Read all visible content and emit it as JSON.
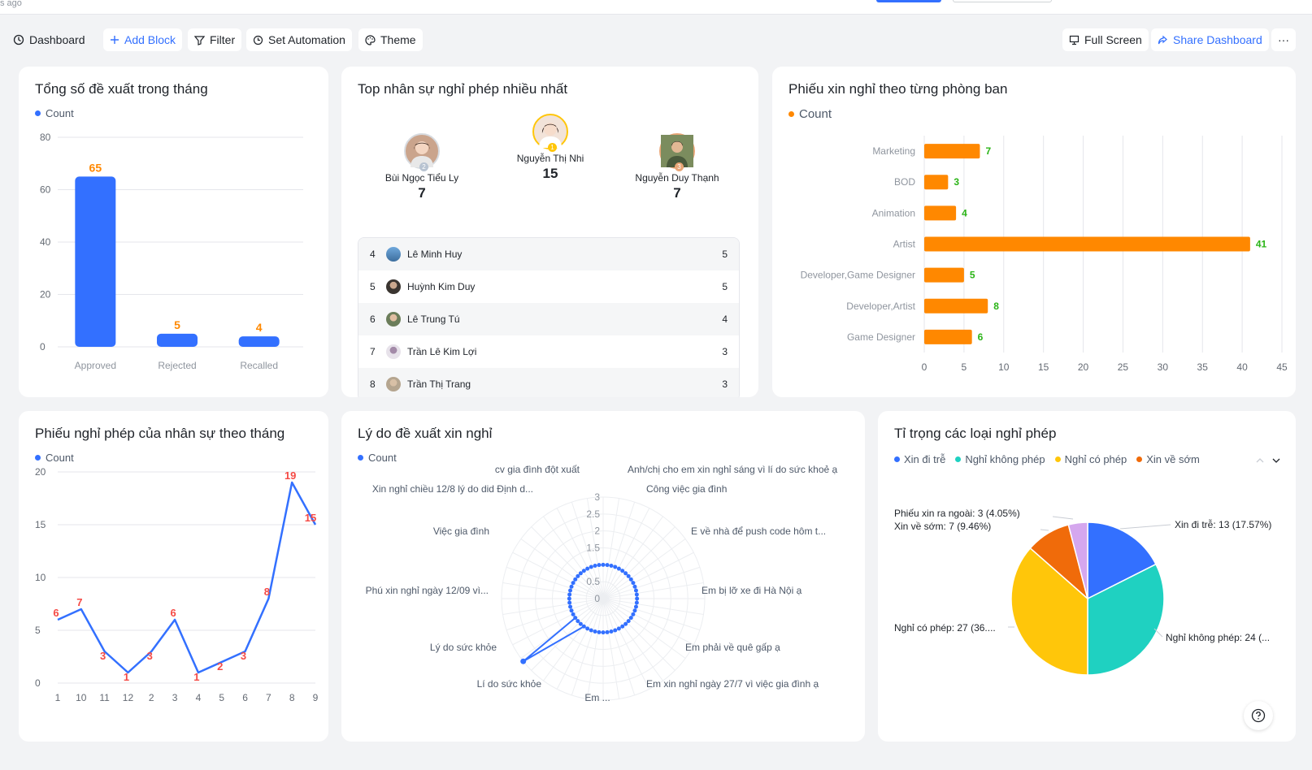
{
  "topbar": {
    "ago_text": "s ago"
  },
  "toolbar": {
    "dashboard_label": "Dashboard",
    "add_block_label": "Add Block",
    "filter_label": "Filter",
    "set_automation_label": "Set Automation",
    "theme_label": "Theme",
    "full_screen_label": "Full Screen",
    "share_dashboard_label": "Share Dashboard",
    "more_label": "···"
  },
  "cards": {
    "total_requests": {
      "title": "Tổng số đề xuất trong tháng",
      "legend": "Count"
    },
    "top_leave": {
      "title": "Top nhân sự nghỉ phép nhiều nhất"
    },
    "by_department": {
      "title": "Phiếu xin nghỉ theo từng phòng ban",
      "legend": "Count"
    },
    "monthly": {
      "title": "Phiếu nghỉ phép của nhân sự theo tháng",
      "legend": "Count"
    },
    "reasons": {
      "title": "Lý do đề xuất xin nghỉ",
      "legend": "Count"
    },
    "leave_types": {
      "title": "Tỉ trọng các loại nghỉ phép"
    }
  },
  "colors": {
    "blue": "#3370ff",
    "orange": "#ff8800",
    "teal": "#1fd1c1",
    "yellow": "#ffc60a",
    "dark_orange": "#f06b0a",
    "lilac": "#d5a7ee",
    "green_label": "#2ab416",
    "red_label": "#f54a45"
  },
  "podium": [
    {
      "rank": "2",
      "name": "Bùi Ngọc Tiểu Ly",
      "count": "7"
    },
    {
      "rank": "1",
      "name": "Nguyễn Thị Nhi",
      "count": "15"
    },
    {
      "rank": "3",
      "name": "Nguyễn Duy Thạnh",
      "count": "7"
    }
  ],
  "ranking": [
    {
      "rank": "4",
      "name": "Lê Minh Huy",
      "count": "5"
    },
    {
      "rank": "5",
      "name": "Huỳnh Kim Duy",
      "count": "5"
    },
    {
      "rank": "6",
      "name": "Lê Trung Tú",
      "count": "4"
    },
    {
      "rank": "7",
      "name": "Trần Lê Kim Lợi",
      "count": "3"
    },
    {
      "rank": "8",
      "name": "Trần Thị Trang",
      "count": "3"
    }
  ],
  "chart_data": [
    {
      "id": "total_requests",
      "type": "bar",
      "categories": [
        "Approved",
        "Rejected",
        "Recalled"
      ],
      "series": [
        {
          "name": "Count",
          "values": [
            65,
            5,
            4
          ]
        }
      ],
      "ylim": [
        0,
        80
      ],
      "yticks": [
        0,
        20,
        40,
        60,
        80
      ],
      "grid": true,
      "legend": "top-left"
    },
    {
      "id": "by_department",
      "type": "bar",
      "orientation": "horizontal",
      "categories": [
        "Marketing",
        "BOD",
        "Animation",
        "Artist",
        "Developer,Game Designer",
        "Developer,Artist",
        "Game Designer"
      ],
      "series": [
        {
          "name": "Count",
          "values": [
            7,
            3,
            4,
            41,
            5,
            8,
            6
          ]
        }
      ],
      "xlim": [
        0,
        45
      ],
      "xticks": [
        0,
        5,
        10,
        15,
        20,
        25,
        30,
        35,
        40,
        45
      ],
      "grid": true,
      "legend": "top-left"
    },
    {
      "id": "monthly",
      "type": "line",
      "categories": [
        "1",
        "10",
        "11",
        "12",
        "2",
        "3",
        "4",
        "5",
        "6",
        "7",
        "8",
        "9"
      ],
      "x": [
        0,
        1,
        1.5,
        2,
        3,
        3.5,
        4.5,
        5,
        5.5,
        6,
        6.5,
        7.5,
        8,
        9,
        9.5,
        10,
        11
      ],
      "values": [
        6,
        7,
        3,
        1,
        3,
        6,
        1,
        2,
        3,
        8,
        19,
        15
      ],
      "series": [
        {
          "name": "Count",
          "x": [
            0,
            0.9,
            1.7,
            2.7,
            3.7,
            4.7,
            5.7,
            6.7,
            7.7,
            8.7,
            9.7,
            11
          ],
          "values": [
            6,
            7,
            3,
            1,
            3,
            6,
            1,
            2,
            3,
            8,
            19,
            15
          ],
          "labels": [
            "6",
            "7",
            "3",
            "1",
            "3",
            "6",
            "1",
            "2",
            "3",
            "8",
            "19",
            "15"
          ]
        }
      ],
      "ylim": [
        0,
        20
      ],
      "yticks": [
        0,
        5,
        10,
        15,
        20
      ],
      "grid": true,
      "legend": "top-left"
    },
    {
      "id": "reasons",
      "type": "radar",
      "axes": [
        "Anh/chị cho em xin nghỉ sáng vì lí do sức khoẻ ạ",
        "Công việc gia đình",
        "E về nhà để push code hôm t...",
        "Em bị lỡ xe đi Hà Nội ạ",
        "Em phải về quê gấp ạ",
        "Em xin nghỉ ngày 27/7 vì việc gia đình ạ",
        "Em ...",
        "Lí do sức khỏe",
        "Lý do sức khỏe",
        "Phú xin nghỉ ngày 12/09 vì...",
        "Việc gia đình",
        "Xin nghỉ chiều 12/8 lý do did Định d...",
        "cv gia đình đột xuất"
      ],
      "series": [
        {
          "name": "Count",
          "values": [
            1,
            1,
            1,
            1,
            1,
            1,
            1,
            1,
            3,
            1,
            1,
            1,
            1
          ]
        }
      ],
      "rlim": [
        0,
        3
      ],
      "rticks": [
        "0",
        "0.5",
        "1.5",
        "2",
        "2.5",
        "3"
      ],
      "legend": "top-left"
    },
    {
      "id": "leave_types",
      "type": "pie",
      "legend_entries": [
        "Xin đi trễ",
        "Nghỉ không phép",
        "Nghỉ có phép",
        "Xin về sớm"
      ],
      "slices": [
        {
          "name": "Xin đi trễ",
          "value": 13,
          "label": "Xin đi trễ: 13 (17.57%)"
        },
        {
          "name": "Nghỉ không phép",
          "value": 24,
          "label": "Nghỉ không phép: 24 (..."
        },
        {
          "name": "Nghỉ có phép",
          "value": 27,
          "label": "Nghỉ có phép: 27 (36...."
        },
        {
          "name": "Xin về sớm",
          "value": 7,
          "label": "Xin về sớm: 7 (9.46%)"
        },
        {
          "name": "Phiếu xin ra ngoài",
          "value": 3,
          "label": "Phiếu xin ra ngoài: 3 (4.05%)"
        }
      ],
      "legend": "top-left"
    }
  ]
}
